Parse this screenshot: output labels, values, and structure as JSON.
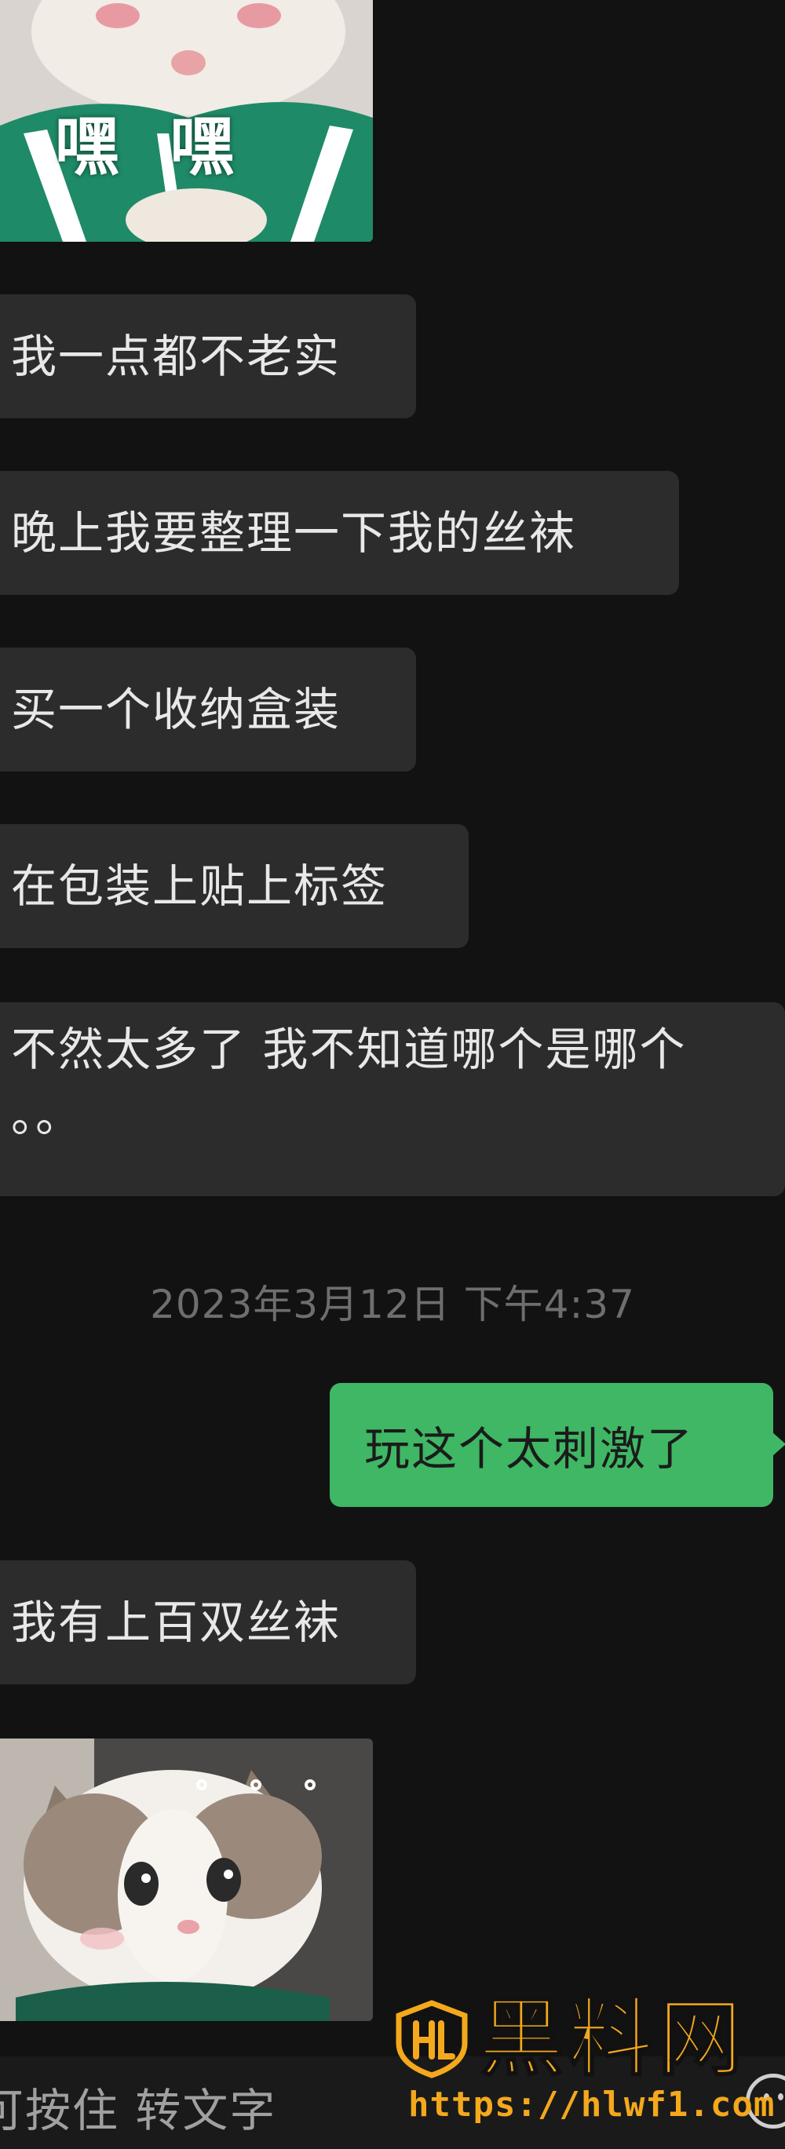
{
  "chat": {
    "stickers": {
      "top_caption": "嘿 嘿"
    },
    "messages_before": [
      {
        "text": "我一点都不老实"
      },
      {
        "text": "晚上我要整理一下我的丝袜"
      },
      {
        "text": "买一个收纳盒装"
      },
      {
        "text": "在包装上贴上标签"
      },
      {
        "line1": "不然太多了 我不知道哪个是哪个",
        "line2": "。。"
      }
    ],
    "timestamp": "2023年3月12日 下午4:37",
    "outgoing": {
      "text": "玩这个太刺激了"
    },
    "messages_after": [
      {
        "text": "我有上百双丝袜"
      }
    ]
  },
  "input_bar": {
    "hold_to_text": "可按住 转文字",
    "emoji_icon": "emoji-icon"
  },
  "watermark": {
    "title": "黑料网",
    "url": "https://hlwf1.com",
    "logo": "hl-shield-logo",
    "color": "#f4a81c"
  },
  "colors": {
    "background": "#121212",
    "incoming_bubble": "#2c2c2c",
    "outgoing_bubble": "#3fb764",
    "timestamp": "#6e6e6e"
  }
}
